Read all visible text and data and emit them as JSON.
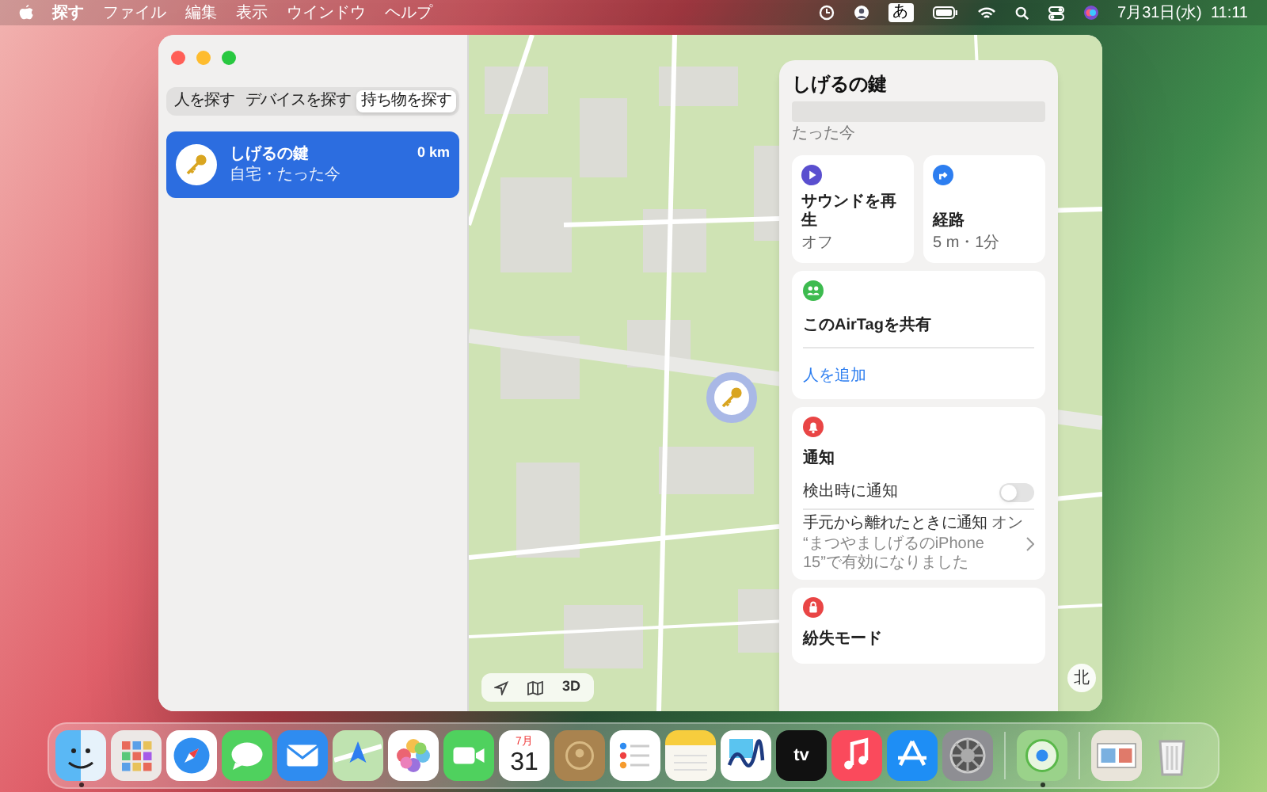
{
  "menu_bar": {
    "app": "探す",
    "menus": [
      "ファイル",
      "編集",
      "表示",
      "ウインドウ",
      "ヘルプ"
    ],
    "input_mode": "あ",
    "clock": "7月31日(水)  11:11"
  },
  "sidebar": {
    "tabs": [
      {
        "label": "人を探す",
        "selected": false
      },
      {
        "label": "デバイスを探す",
        "selected": false
      },
      {
        "label": "持ち物を探す",
        "selected": true
      }
    ],
    "items": [
      {
        "name": "しげるの鍵",
        "detail": "自宅・たった今",
        "distance": "0 km",
        "selected": true
      }
    ]
  },
  "map": {
    "controls": [
      {
        "kind": "location"
      },
      {
        "kind": "map"
      },
      {
        "kind": "text",
        "label": "3D"
      }
    ],
    "compass": "北"
  },
  "detail": {
    "title": "しげるの鍵",
    "updated": "たった今",
    "actions": [
      {
        "kind": "sound",
        "label": "サウンドを再生",
        "status": "オフ"
      },
      {
        "kind": "directions",
        "label": "経路",
        "status": "5 m・1分"
      }
    ],
    "share": {
      "title": "このAirTagを共有",
      "link": "人を追加"
    },
    "notifications": {
      "title": "通知",
      "toggle": {
        "label": "検出時に通知",
        "on": false
      },
      "separation": {
        "label": "手元から離れたときに通知",
        "value": "オン",
        "note": "“まつやましげるのiPhone 15”で有効になりました"
      }
    },
    "lost_mode": {
      "title": "紛失モード"
    }
  },
  "dock": {
    "sections": [
      {
        "apps": [
          {
            "kind": "finder",
            "running": true
          },
          {
            "kind": "launchpad",
            "running": false
          },
          {
            "kind": "safari",
            "running": false
          },
          {
            "kind": "messages",
            "running": false
          },
          {
            "kind": "mail",
            "running": false
          },
          {
            "kind": "maps",
            "running": false
          },
          {
            "kind": "photos",
            "running": false
          },
          {
            "kind": "facetime",
            "running": false
          },
          {
            "kind": "calendar",
            "running": false,
            "month": "7月",
            "day": "31"
          },
          {
            "kind": "contacts",
            "running": false
          },
          {
            "kind": "reminders",
            "running": false
          },
          {
            "kind": "notes",
            "running": false
          },
          {
            "kind": "freeform",
            "running": false
          },
          {
            "kind": "tv",
            "running": false,
            "label": "tv"
          },
          {
            "kind": "music",
            "running": false
          },
          {
            "kind": "appstore",
            "running": false
          },
          {
            "kind": "settings",
            "running": false
          }
        ]
      },
      {
        "apps": [
          {
            "kind": "findmy",
            "running": true
          }
        ]
      },
      {
        "apps": [
          {
            "kind": "stack",
            "running": false
          },
          {
            "kind": "trash",
            "running": false
          }
        ]
      }
    ]
  }
}
